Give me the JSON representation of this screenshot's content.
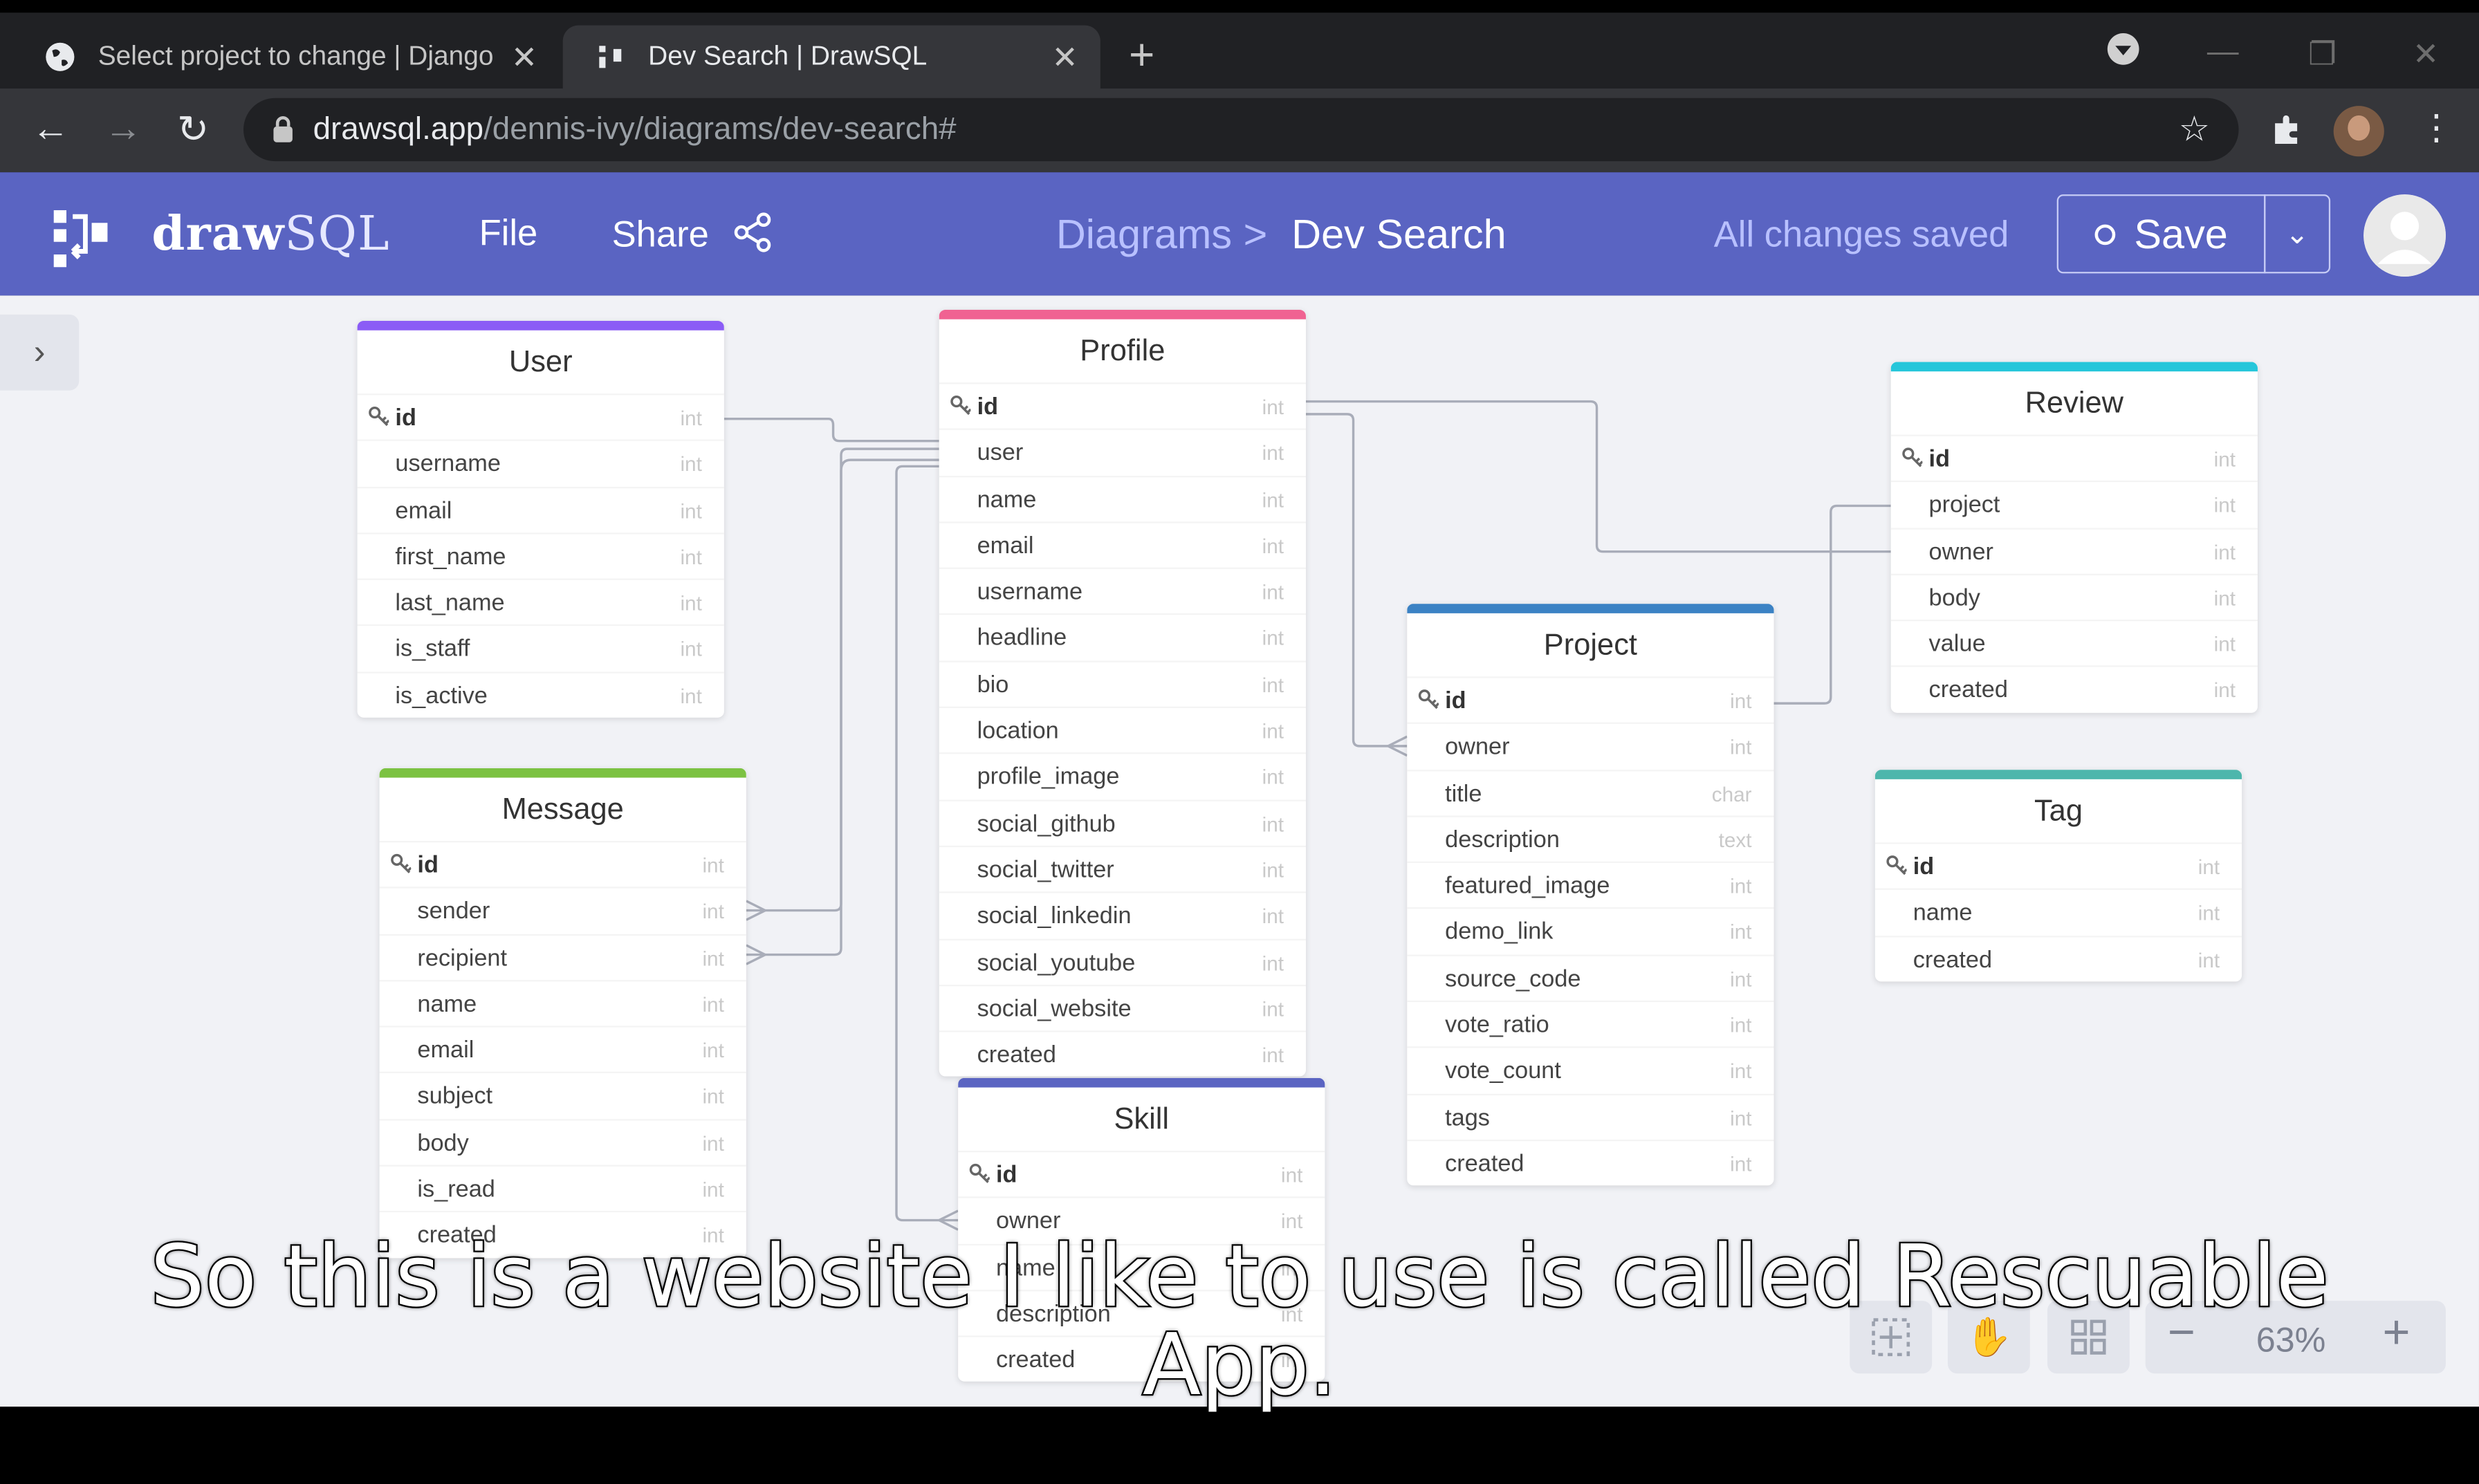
{
  "browser": {
    "tabs": [
      {
        "title": "Select project to change | Django",
        "active": false
      },
      {
        "title": "Dev Search | DrawSQL",
        "active": true
      }
    ],
    "url_host": "drawsql.app",
    "url_path": "/dennis-ivy/diagrams/dev-search#"
  },
  "header": {
    "brand_bold": "draw",
    "brand_light": "SQL",
    "menu": [
      "File",
      "Share"
    ],
    "breadcrumb_parent": "Diagrams >",
    "breadcrumb_current": "Dev Search",
    "status": "All changes saved",
    "save_label": "Save"
  },
  "tables": [
    {
      "name": "User",
      "color": "#8b5cf6",
      "columns": [
        [
          "id",
          "int"
        ],
        [
          "username",
          "int"
        ],
        [
          "email",
          "int"
        ],
        [
          "first_name",
          "int"
        ],
        [
          "last_name",
          "int"
        ],
        [
          "is_staff",
          "int"
        ],
        [
          "is_active",
          "int"
        ]
      ]
    },
    {
      "name": "Profile",
      "color": "#f06292",
      "columns": [
        [
          "id",
          "int"
        ],
        [
          "user",
          "int"
        ],
        [
          "name",
          "int"
        ],
        [
          "email",
          "int"
        ],
        [
          "username",
          "int"
        ],
        [
          "headline",
          "int"
        ],
        [
          "bio",
          "int"
        ],
        [
          "location",
          "int"
        ],
        [
          "profile_image",
          "int"
        ],
        [
          "social_github",
          "int"
        ],
        [
          "social_twitter",
          "int"
        ],
        [
          "social_linkedin",
          "int"
        ],
        [
          "social_youtube",
          "int"
        ],
        [
          "social_website",
          "int"
        ],
        [
          "created",
          "int"
        ]
      ]
    },
    {
      "name": "Review",
      "color": "#26c6da",
      "columns": [
        [
          "id",
          "int"
        ],
        [
          "project",
          "int"
        ],
        [
          "owner",
          "int"
        ],
        [
          "body",
          "int"
        ],
        [
          "value",
          "int"
        ],
        [
          "created",
          "int"
        ]
      ]
    },
    {
      "name": "Project",
      "color": "#3b82c4",
      "columns": [
        [
          "id",
          "int"
        ],
        [
          "owner",
          "int"
        ],
        [
          "title",
          "char"
        ],
        [
          "description",
          "text"
        ],
        [
          "featured_image",
          "int"
        ],
        [
          "demo_link",
          "int"
        ],
        [
          "source_code",
          "int"
        ],
        [
          "vote_ratio",
          "int"
        ],
        [
          "vote_count",
          "int"
        ],
        [
          "tags",
          "int"
        ],
        [
          "created",
          "int"
        ]
      ]
    },
    {
      "name": "Message",
      "color": "#7cc242",
      "columns": [
        [
          "id",
          "int"
        ],
        [
          "sender",
          "int"
        ],
        [
          "recipient",
          "int"
        ],
        [
          "name",
          "int"
        ],
        [
          "email",
          "int"
        ],
        [
          "subject",
          "int"
        ],
        [
          "body",
          "int"
        ],
        [
          "is_read",
          "int"
        ],
        [
          "created",
          "int"
        ]
      ]
    },
    {
      "name": "Tag",
      "color": "#4db6ac",
      "columns": [
        [
          "id",
          "int"
        ],
        [
          "name",
          "int"
        ],
        [
          "created",
          "int"
        ]
      ]
    },
    {
      "name": "Skill",
      "color": "#5a64c2",
      "columns": [
        [
          "id",
          "int"
        ],
        [
          "owner",
          "int"
        ],
        [
          "name",
          "int"
        ],
        [
          "description",
          "int"
        ],
        [
          "created",
          "int"
        ]
      ]
    }
  ],
  "zoom": "63%",
  "caption_line1": "So this is a website I like to use is called Rescuable",
  "caption_line2": "App."
}
